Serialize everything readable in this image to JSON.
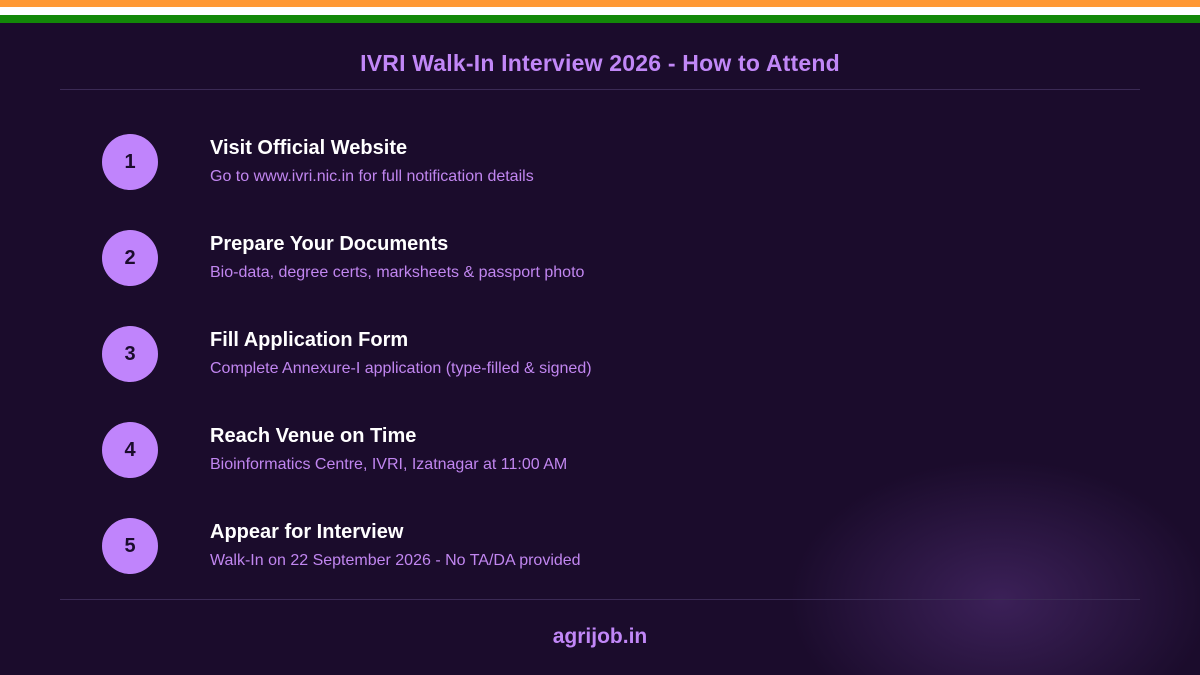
{
  "header": {
    "title": "IVRI Walk-In Interview 2026 - How to Attend"
  },
  "steps": [
    {
      "number": "1",
      "title": "Visit Official Website",
      "description": "Go to www.ivri.nic.in for full notification details"
    },
    {
      "number": "2",
      "title": "Prepare Your Documents",
      "description": "Bio-data, degree certs, marksheets & passport photo"
    },
    {
      "number": "3",
      "title": "Fill Application Form",
      "description": "Complete Annexure-I application (type-filled & signed)"
    },
    {
      "number": "4",
      "title": "Reach Venue on Time",
      "description": "Bioinformatics Centre, IVRI, Izatnagar at 11:00 AM"
    },
    {
      "number": "5",
      "title": "Appear for Interview",
      "description": "Walk-In on 22 September 2026 - No TA/DA provided"
    }
  ],
  "footer": {
    "site": "agrijob.in"
  },
  "colors": {
    "background": "#1b0c2c",
    "accent": "#c084fc",
    "flag_saffron": "#ff9933",
    "flag_white": "#ffffff",
    "flag_green": "#138808"
  }
}
